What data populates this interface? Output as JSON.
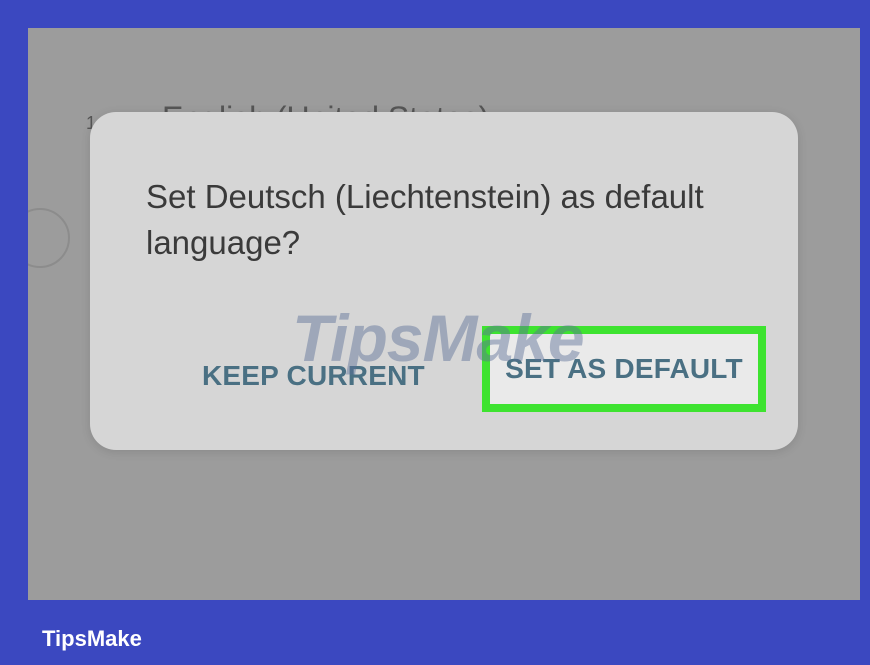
{
  "background_list": {
    "item_number": "1",
    "item_label": "English (United States)"
  },
  "dialog": {
    "title": "Set Deutsch (Liechtenstein) as default language?",
    "keep_label": "KEEP CURRENT",
    "default_label": "SET AS DEFAULT"
  },
  "watermark": {
    "text": "TipsMake"
  },
  "footer": {
    "brand": "TipsMake"
  },
  "colors": {
    "frame": "#3b48c0",
    "screen_dim": "#9c9c9c",
    "dialog_bg": "#d6d6d6",
    "button_text": "#4a7083",
    "highlight": "#3ee330"
  }
}
